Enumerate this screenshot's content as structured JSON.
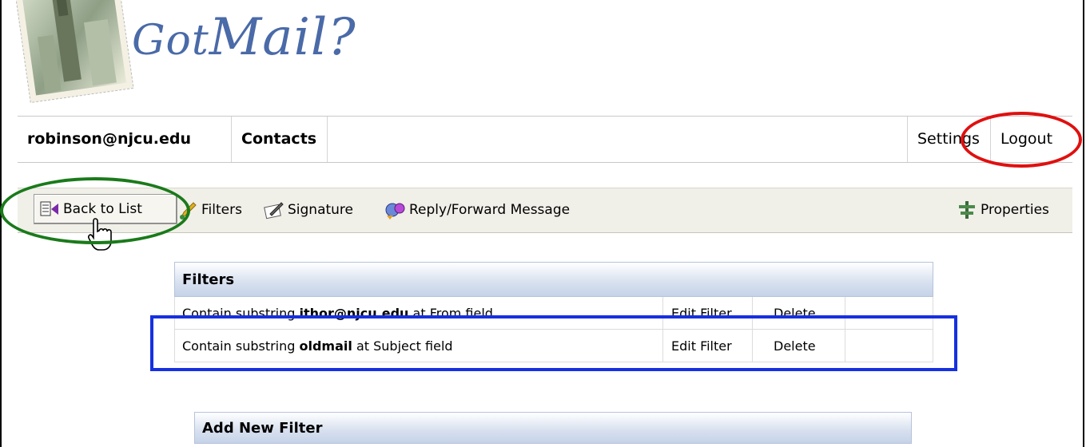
{
  "logo": {
    "text_got": "Got",
    "text_mail": "Mail?",
    "color": "#4a6aa8"
  },
  "nav": {
    "user": "robinson@njcu.edu",
    "contacts": "Contacts",
    "settings": "Settings",
    "logout": "Logout"
  },
  "toolbar": {
    "back": "Back to List",
    "filters": "Filters",
    "signature": "Signature",
    "reply_forward": "Reply/Forward Message",
    "properties": "Properties"
  },
  "filters": {
    "title": "Filters",
    "rows": [
      {
        "prefix": "Contain substring ",
        "term": "ithor@njcu.edu",
        "suffix": " at From field",
        "edit": "Edit Filter",
        "delete": "Delete"
      },
      {
        "prefix": "Contain substring ",
        "term": "oldmail",
        "suffix": " at Subject field",
        "edit": "Edit Filter",
        "delete": "Delete"
      }
    ]
  },
  "add_filter": {
    "title": "Add New Filter"
  },
  "annotations": {
    "red": "#e01010",
    "green": "#1a7a1a",
    "blue": "#1630e0"
  }
}
